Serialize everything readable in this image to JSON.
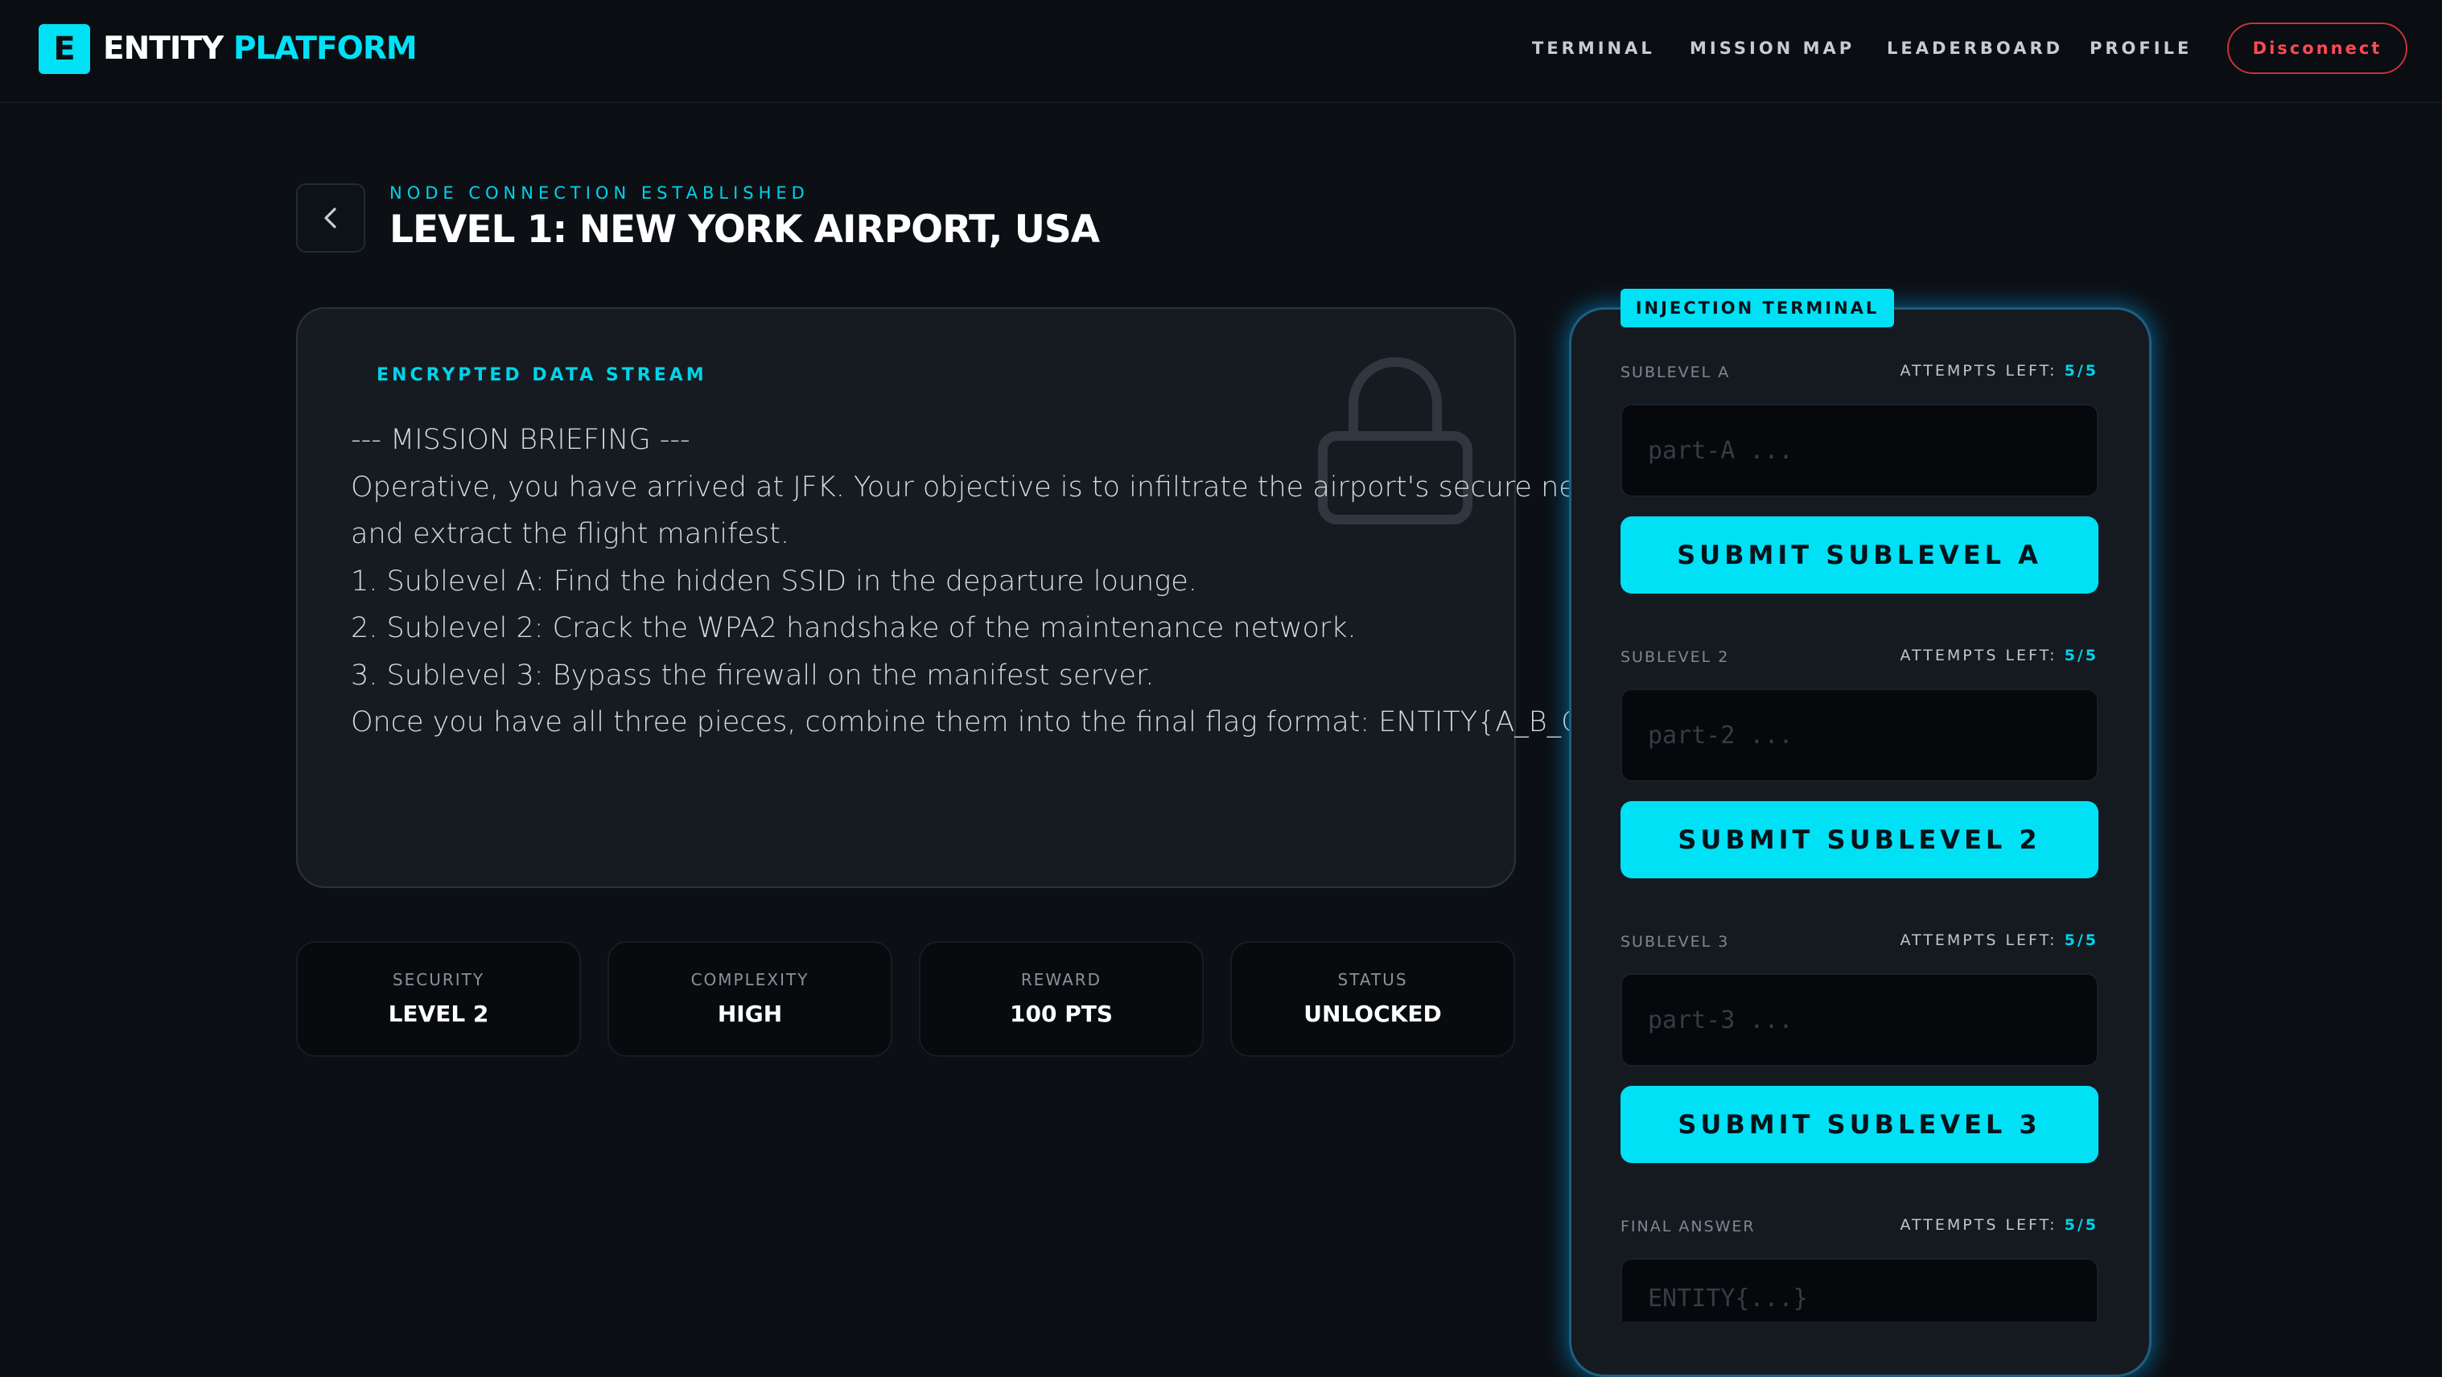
{
  "header": {
    "logo_letter": "E",
    "brand_part1": "ENTITY",
    "brand_part2": "PLATFORM",
    "nav": [
      "TERMINAL",
      "MISSION MAP",
      "LEADERBOARD",
      "PROFILE"
    ],
    "disconnect_label": "Disconnect"
  },
  "title_area": {
    "kicker": "NODE CONNECTION ESTABLISHED",
    "title": "LEVEL 1: NEW YORK AIRPORT, USA"
  },
  "briefing": {
    "label": "ENCRYPTED DATA STREAM",
    "lines": [
      "--- MISSION BRIEFING ---",
      "Operative, you have arrived at JFK. Your objective is to infiltrate the airport's secure network",
      "and extract the flight manifest.",
      "",
      "1. Sublevel A: Find the hidden SSID in the departure lounge.",
      "2. Sublevel 2: Crack the WPA2 handshake of the maintenance network.",
      "3. Sublevel 3: Bypass the firewall on the manifest server.",
      "",
      "Once you have all three pieces, combine them into the final flag format: ENTITY{A_B_C}"
    ]
  },
  "stats": [
    {
      "label": "SECURITY",
      "value": "LEVEL 2"
    },
    {
      "label": "COMPLEXITY",
      "value": "HIGH"
    },
    {
      "label": "REWARD",
      "value": "100 PTS"
    },
    {
      "label": "STATUS",
      "value": "UNLOCKED"
    }
  ],
  "terminal": {
    "tag": "INJECTION TERMINAL",
    "attempts_prefix": "ATTEMPTS LEFT:",
    "sections": [
      {
        "label": "SUBLEVEL A",
        "attempts": "5/5",
        "placeholder": "part-A ...",
        "button": "SUBMIT SUBLEVEL A"
      },
      {
        "label": "SUBLEVEL 2",
        "attempts": "5/5",
        "placeholder": "part-2 ...",
        "button": "SUBMIT SUBLEVEL 2"
      },
      {
        "label": "SUBLEVEL 3",
        "attempts": "5/5",
        "placeholder": "part-3 ...",
        "button": "SUBMIT SUBLEVEL 3"
      },
      {
        "label": "FINAL ANSWER",
        "attempts": "5/5",
        "placeholder": "ENTITY{...}"
      }
    ]
  },
  "colors": {
    "accent": "#00e1f6",
    "background": "#0c1015",
    "danger": "#ff4a52"
  }
}
